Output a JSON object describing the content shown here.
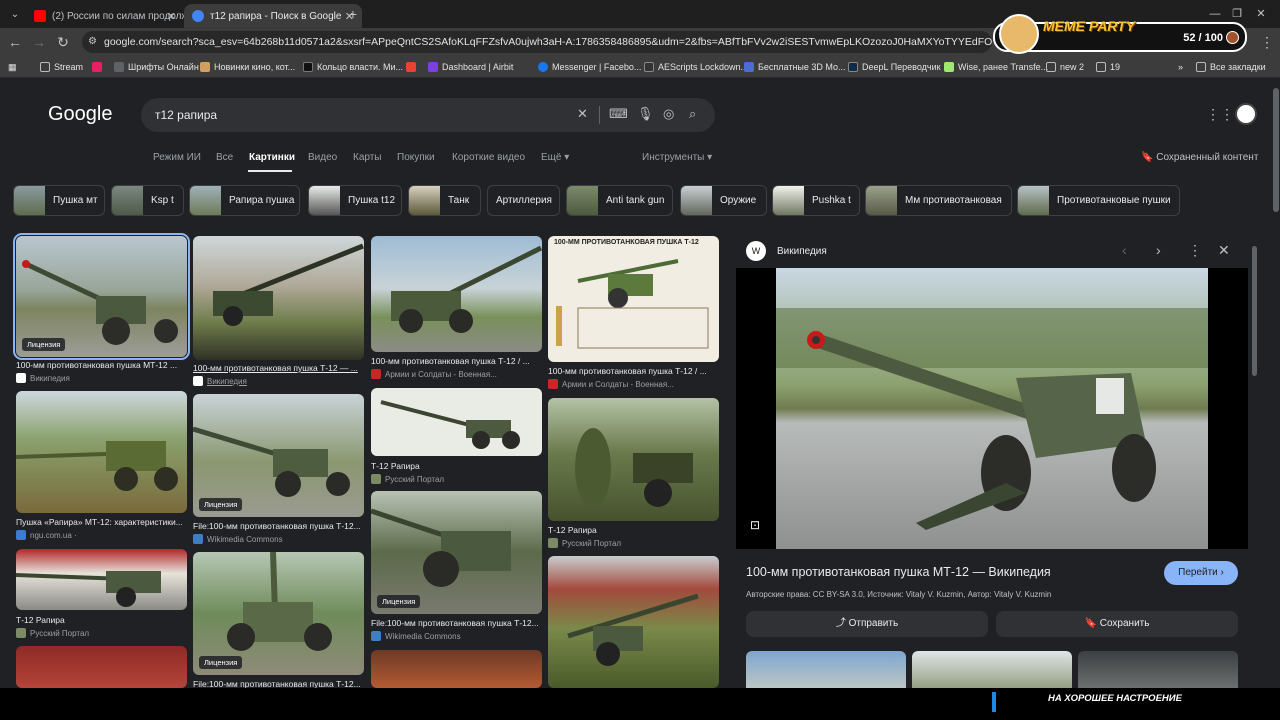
{
  "browser": {
    "tabs": [
      {
        "label": "(2) России по силам продолж",
        "favicon_color": "#ff0000",
        "active": false
      },
      {
        "label": "т12 рапира - Поиск в Google",
        "favicon_color": "#4285f4",
        "active": true
      }
    ],
    "url": "google.com/search?sca_esv=64b268b11d0571a2&sxsrf=APpeQntCS2SAfoKLqFFZsfvA0ujwh3aH-A:1786358486895&udm=2&fbs=ABfTbFVv2w2iSESTvmwEpLKOzozoJ0HaMXYoTYYEdFOtDfJk9xqXiUf4j3IkfillYg6yoQjk",
    "bookmarks": [
      {
        "label": "Stream",
        "color": "#5f6368"
      },
      {
        "label": "",
        "color": "#e91e63"
      },
      {
        "label": "Шрифты Онлайн",
        "color": "#5f6368"
      },
      {
        "label": "Новинки кино, кот...",
        "color": "#d0a060"
      },
      {
        "label": "Кольцо власти. Ми...",
        "color": "#1a1a1a"
      },
      {
        "label": "",
        "color": "#ea4335"
      },
      {
        "label": "Dashboard | Airbit",
        "color": "#7b3fe4"
      },
      {
        "label": "Messenger | Facebo...",
        "color": "#1877f2"
      },
      {
        "label": "AEScripts Lockdown...",
        "color": "#333"
      },
      {
        "label": "Бесплатные 3D Мо...",
        "color": "#4a6cd4"
      },
      {
        "label": "DeepL Переводчик",
        "color": "#0f2b46"
      },
      {
        "label": "Wise, ранее Transfe...",
        "color": "#9fe870"
      },
      {
        "label": "new 2",
        "color": "#5f6368"
      },
      {
        "label": "19",
        "color": "#5f6368"
      },
      {
        "label": "Все закладки",
        "color": "#5f6368"
      }
    ]
  },
  "overlay": {
    "title": "MEME PARTY",
    "score": "52 / 100",
    "bottom_text": "НА ХОРОШЕЕ НАСТРОЕНИЕ"
  },
  "google": {
    "logo": "Google",
    "query": "т12 рапира",
    "tabs": [
      "Режим ИИ",
      "Все",
      "Картинки",
      "Видео",
      "Карты",
      "Покупки",
      "Короткие видео",
      "Ещё",
      "Инструменты"
    ],
    "saved": "Сохраненный контент",
    "chips": [
      "Пушка мт",
      "Ksp t",
      "Рапира пушка",
      "Пушка t12",
      "Танк",
      "Артиллерия",
      "Anti tank gun",
      "Оружие",
      "Pushka t",
      "Мм противотанковая",
      "Противотанковые пушки"
    ]
  },
  "results": [
    {
      "caption": "100-мм противотанковая пушка МТ-12 ...",
      "source": "Википедия",
      "license": "Лицензия"
    },
    {
      "caption": "100-мм противотанковая пушка Т-12 — ...",
      "source": "Википедия",
      "license": ""
    },
    {
      "caption": "100-мм противотанковая пушка Т-12 / ...",
      "source": "Армии и Солдаты - Военная...",
      "license": ""
    },
    {
      "caption": "100-мм противотанковая пушка Т-12 / ...",
      "source": "Армии и Солдаты - Военная...",
      "license": ""
    },
    {
      "caption": "Пушка «Рапира» МТ-12: характеристики...",
      "source": "ngu.com.ua ·",
      "license": ""
    },
    {
      "caption": "File:100-мм противотанковая пушка Т-12...",
      "source": "Wikimedia Commons",
      "license": "Лицензия"
    },
    {
      "caption": "Т-12 Рапира",
      "source": "Русский Портал",
      "license": ""
    },
    {
      "caption": "Т-12 Рапира",
      "source": "Русский Портал",
      "license": ""
    },
    {
      "caption": "Т-12 Рапира",
      "source": "Русский Портал",
      "license": ""
    },
    {
      "caption": "File:100-мм противотанковая пушка Т-12...",
      "source": "Wikimedia Commons",
      "license": "Лицензия"
    },
    {
      "caption": "File:100-мм противотанковая пушка Т-12...",
      "source": "Wikimedia Commons",
      "license": "Лицензия"
    },
    {
      "caption": "File:100-мм противотанковая пушка Т-12...",
      "source": "",
      "license": "Лицензия"
    },
    {
      "caption": "",
      "source": "",
      "license": ""
    },
    {
      "caption": "",
      "source": "",
      "license": ""
    },
    {
      "caption": "",
      "source": "",
      "license": ""
    }
  ],
  "poster_title": "100-ММ ПРОТИВОТАНКОВАЯ ПУШКА Т-12",
  "panel": {
    "site": "Википедия",
    "title": "100-мм противотанковая пушка МТ-12 — Википедия",
    "copyright": "Авторские права: CC BY-SA 3.0, Источник: Vitaly V. Kuzmin, Автор: Vitaly V. Kuzmin",
    "goto": "Перейти",
    "share": "Отправить",
    "save": "Сохранить"
  }
}
